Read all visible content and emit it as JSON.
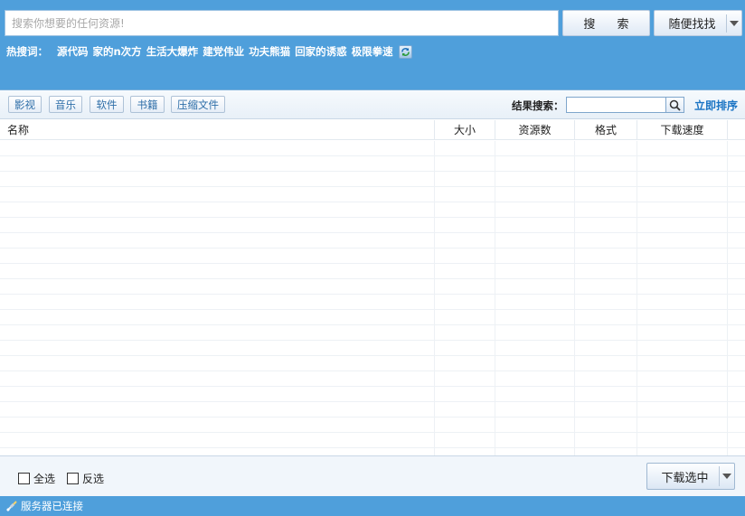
{
  "search": {
    "placeholder": "搜索你想要的任何资源!",
    "button_label": "搜 索",
    "random_label": "随便找找"
  },
  "hot": {
    "title": "热搜词：",
    "keywords": [
      "源代码",
      "家的n次方",
      "生活大爆炸",
      "建党伟业",
      "功夫熊猫",
      "回家的诱惑",
      "极限拳速"
    ]
  },
  "categories": [
    "影视",
    "音乐",
    "软件",
    "书籍",
    "压缩文件"
  ],
  "result_search": {
    "label": "结果搜索：",
    "value": "",
    "sort_link": "立即排序"
  },
  "table": {
    "columns": [
      "名称",
      "大小",
      "资源数",
      "格式",
      "下载速度"
    ],
    "rows": []
  },
  "bottom": {
    "select_all": "全选",
    "invert": "反选",
    "download_label": "下载选中"
  },
  "status": {
    "text": "服务器已连接"
  },
  "colors": {
    "header_blue": "#4f9fdb",
    "link_blue": "#1a74c4"
  }
}
